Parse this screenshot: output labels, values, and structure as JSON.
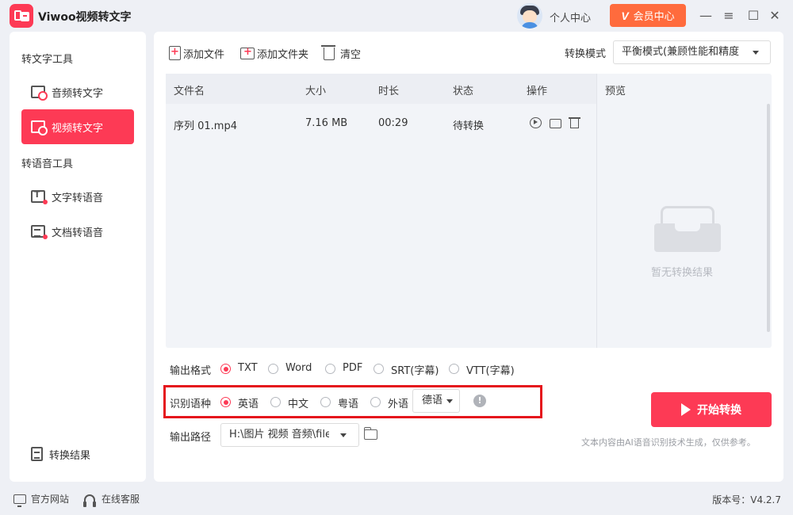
{
  "app": {
    "title": "Viwoo视频转文字"
  },
  "header": {
    "profile_label": "个人中心",
    "vip_label": "会员中心",
    "vip_icon": "V"
  },
  "window": {
    "minimize": "—",
    "restore": "≡",
    "maximize": "☐",
    "close": "✕"
  },
  "sidebar": {
    "group1_title": "转文字工具",
    "group2_title": "转语音工具",
    "items": [
      {
        "label": "音频转文字",
        "icon": "audio-to-text-icon"
      },
      {
        "label": "视频转文字",
        "icon": "video-to-text-icon",
        "active": true
      },
      {
        "label": "文字转语音",
        "icon": "text-to-speech-icon"
      },
      {
        "label": "文档转语音",
        "icon": "document-to-speech-icon"
      }
    ],
    "results_label": "转换结果"
  },
  "toolbar": {
    "add_file": "添加文件",
    "add_folder": "添加文件夹",
    "clear": "清空",
    "mode_label": "转换模式",
    "mode_value": "平衡模式(兼顾性能和精度"
  },
  "table": {
    "headers": {
      "name": "文件名",
      "size": "大小",
      "duration": "时长",
      "status": "状态",
      "ops": "操作"
    },
    "rows": [
      {
        "name": "序列 01.mp4",
        "size": "7.16 MB",
        "duration": "00:29",
        "status": "待转换"
      }
    ]
  },
  "preview": {
    "title": "预览",
    "empty_text": "暂无转换结果"
  },
  "output_format": {
    "label": "输出格式",
    "options": [
      "TXT",
      "Word",
      "PDF",
      "SRT(字幕)",
      "VTT(字幕)"
    ],
    "selected": "TXT"
  },
  "language": {
    "label": "识别语种",
    "options": [
      "英语",
      "中文",
      "粤语",
      "外语"
    ],
    "selected": "英语",
    "foreign_value": "德语",
    "info_glyph": "!"
  },
  "output_path": {
    "label": "输出路径",
    "value": "H:\\图片 视频 音频\\file"
  },
  "start": {
    "label": "开始转换"
  },
  "disclaimer": "文本内容由AI语音识别技术生成，仅供参考。",
  "statusbar": {
    "website": "官方网站",
    "support": "在线客服",
    "version": "版本号：V4.2.7"
  },
  "colors": {
    "accent": "#fd3a55",
    "vip": "#ff6b3d",
    "highlight": "#e5141c"
  }
}
